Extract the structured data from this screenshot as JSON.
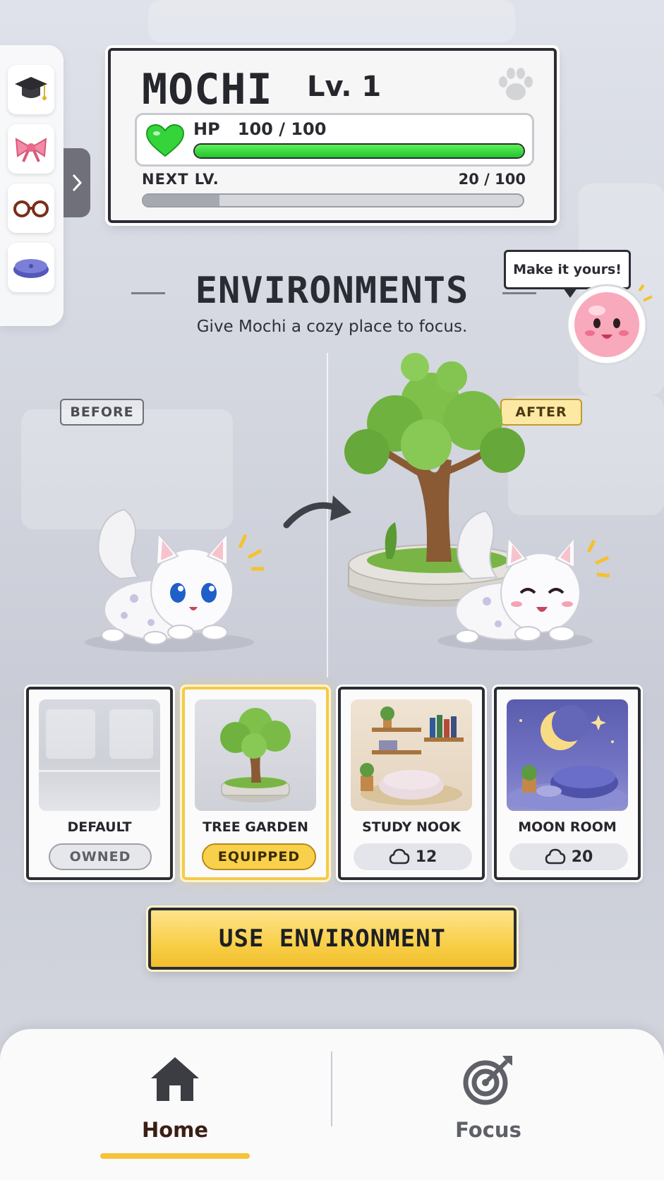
{
  "pet": {
    "name": "MOCHI",
    "level": "Lv. 1",
    "hp_label": "HP",
    "hp_value": "100 / 100",
    "hp_fraction": 1.0,
    "next_label": "NEXT LV.",
    "xp_value": "20 / 100",
    "xp_fraction": 0.2
  },
  "accessories": [
    {
      "icon": "graduation-cap-icon"
    },
    {
      "icon": "bow-icon"
    },
    {
      "icon": "glasses-icon"
    },
    {
      "icon": "cushion-icon"
    }
  ],
  "section": {
    "title": "ENVIRONMENTS",
    "subtitle": "Give Mochi a cozy place to focus."
  },
  "mascot": {
    "speech": "Make it yours!"
  },
  "preview": {
    "before_label": "BEFORE",
    "after_label": "AFTER"
  },
  "environments": [
    {
      "name": "DEFAULT",
      "status": "OWNED"
    },
    {
      "name": "TREE GARDEN",
      "status": "EQUIPPED"
    },
    {
      "name": "STUDY NOOK",
      "price": "12"
    },
    {
      "name": "MOON ROOM",
      "price": "20"
    }
  ],
  "cta": {
    "label": "USE ENVIRONMENT"
  },
  "nav": {
    "home": "Home",
    "focus": "Focus"
  },
  "colors": {
    "hp_green": "#22c42c",
    "accent_yellow": "#f8cf48",
    "outline": "#2b2d33"
  }
}
